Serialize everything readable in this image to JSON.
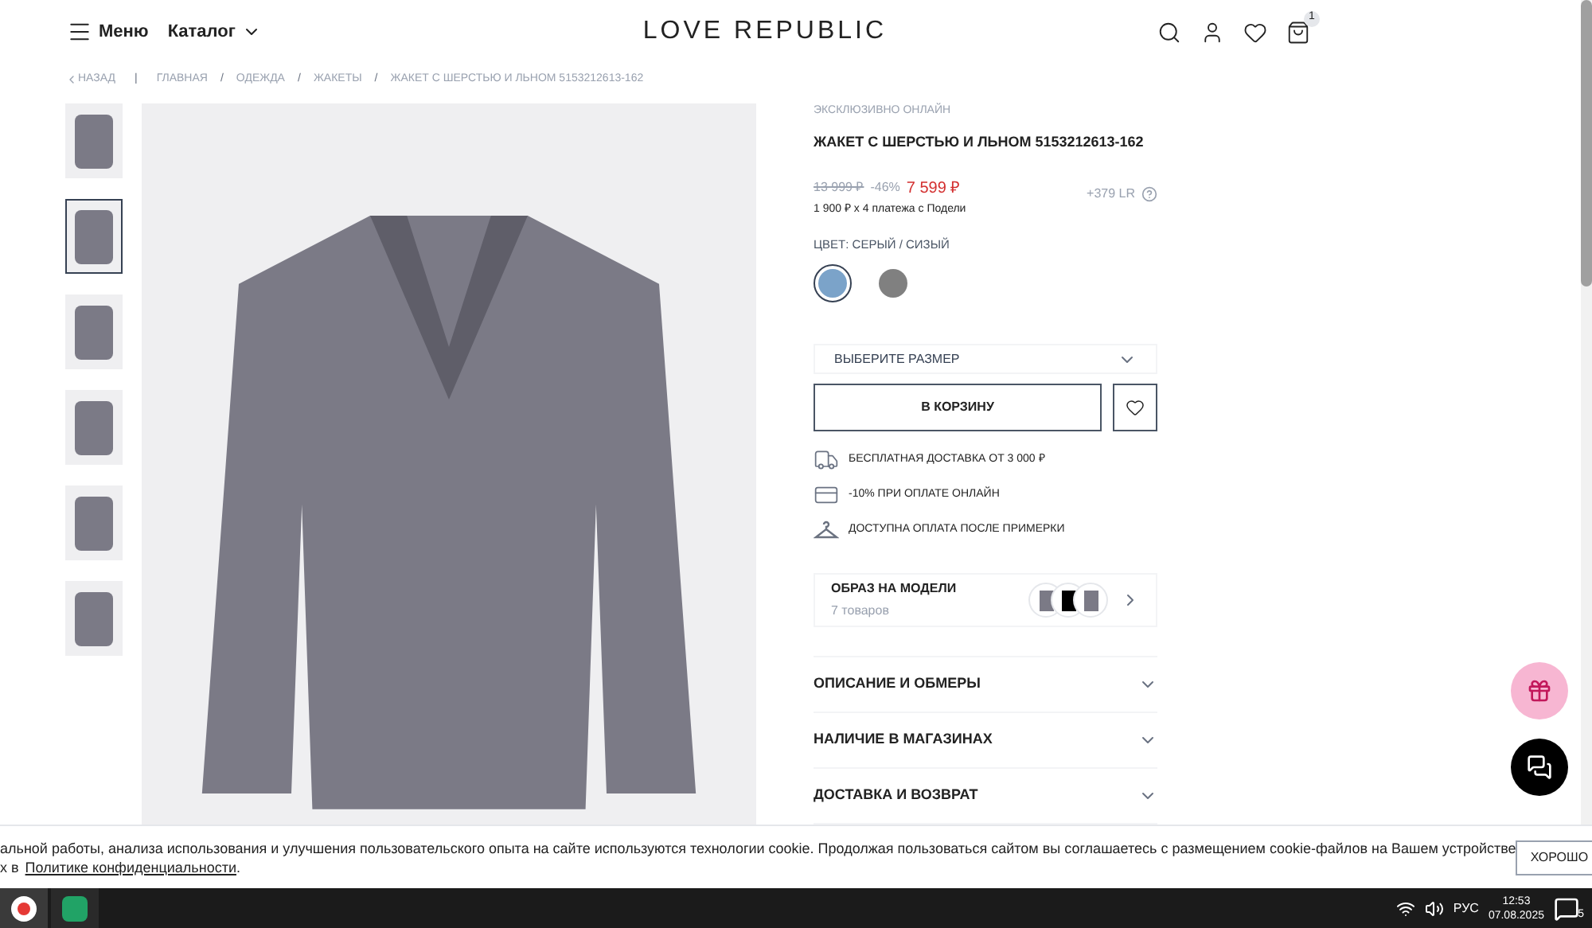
{
  "header": {
    "menu_label": "Меню",
    "catalog_label": "Каталог",
    "logo": "LOVE REPUBLIC",
    "cart_count": "1"
  },
  "breadcrumb": {
    "back": "НАЗАД",
    "divider": "|",
    "separator": "/",
    "items": [
      "ГЛАВНАЯ",
      "ОДЕЖДА",
      "ЖАКЕТЫ",
      "ЖАКЕТ С ШЕРСТЬЮ И ЛЬНОМ 5153212613-162"
    ]
  },
  "thumbnails": [
    {
      "selected": false
    },
    {
      "selected": true
    },
    {
      "selected": false
    },
    {
      "selected": false
    },
    {
      "selected": false
    },
    {
      "selected": false
    }
  ],
  "product": {
    "badge": "ЭКСКЛЮЗИВНО ОНЛАЙН",
    "title": "ЖАКЕТ С ШЕРСТЬЮ И ЛЬНОМ 5153212613-162",
    "old_price": "13 999 ₽",
    "discount": "-46%",
    "price": "7 599 ₽",
    "installments": "1 900 ₽ x 4 платежа с Подели",
    "bonus": "+379 LR",
    "color_label": "ЦВЕТ: СЕРЫЙ / СИЗЫЙ",
    "colors": [
      {
        "color": "#7ba3c9",
        "selected": true
      },
      {
        "color": "#808080",
        "selected": false
      }
    ],
    "size_select": "ВЫБЕРИТЕ РАЗМЕР",
    "add_to_cart": "В КОРЗИНУ",
    "perks": [
      {
        "kind": "truck",
        "text": "БЕСПЛАТНАЯ ДОСТАВКА ОТ 3 000 ₽"
      },
      {
        "kind": "card",
        "text": "-10% ПРИ ОПЛАТЕ ОНЛАЙН"
      },
      {
        "kind": "hanger",
        "text": "ДОСТУПНА ОПЛАТА ПОСЛЕ ПРИМЕРКИ"
      }
    ],
    "look": {
      "title": "ОБРАЗ НА МОДЕЛИ",
      "count": "7 товаров"
    },
    "accordions": [
      {
        "title": "ОПИСАНИЕ И ОБМЕРЫ",
        "expanded": false
      },
      {
        "title": "НАЛИЧИЕ В МАГАЗИНАХ",
        "expanded": false
      },
      {
        "title": "ДОСТАВКА И ВОЗВРАТ",
        "expanded": false
      }
    ]
  },
  "cookie": {
    "line1": "альной работы, анализа использования и улучшения пользовательского опыта на сайте используются технологии cookie. Продолжая пользоваться сайтом вы соглашаетесь с размещением cookie-файлов на Вашем устройстве",
    "line2_prefix": "х в",
    "link": "Политике конфиденциальности",
    "line2_suffix": ".",
    "button": "ХОРОШО"
  },
  "taskbar": {
    "language": "РУС",
    "time": "12:53",
    "date": "07.08.2025",
    "notifications": "5"
  }
}
